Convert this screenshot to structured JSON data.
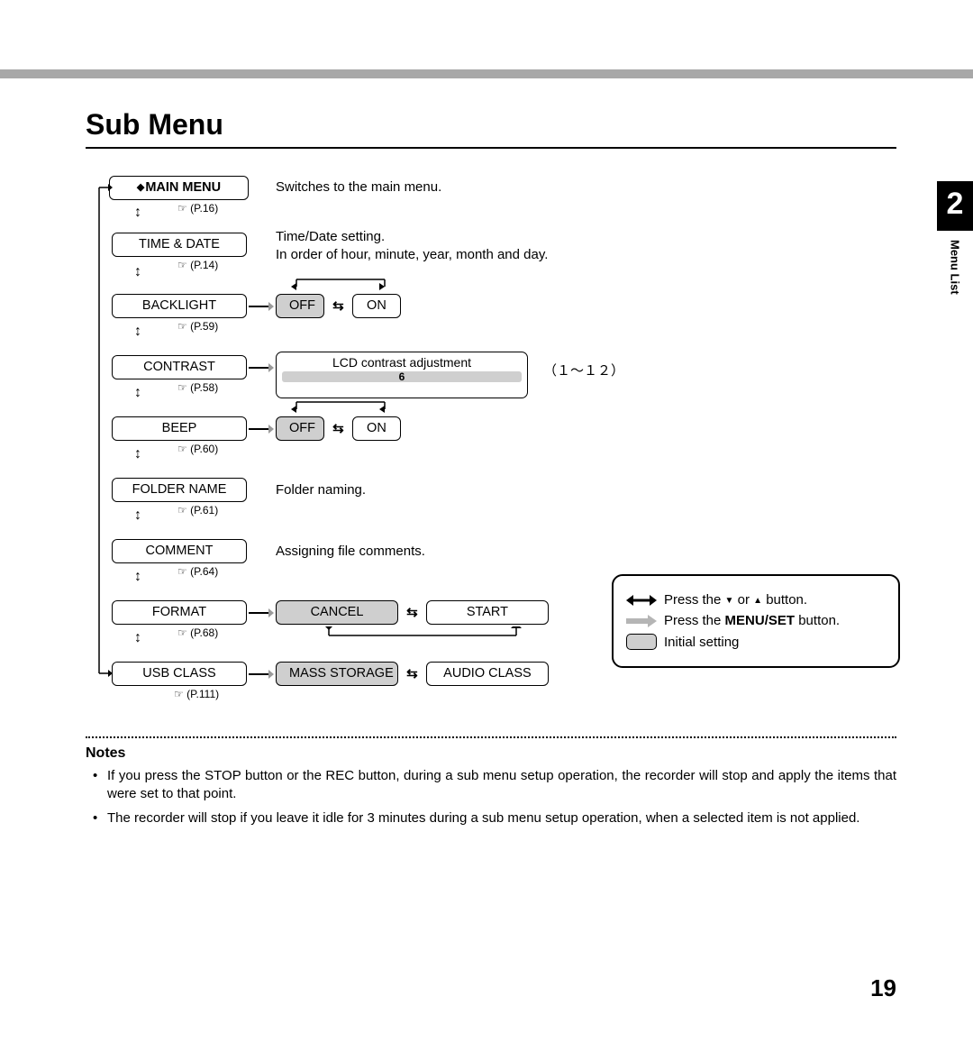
{
  "page": {
    "title": "Sub Menu",
    "number": "19",
    "chapter_number": "2",
    "chapter_label": "Menu List"
  },
  "menu": {
    "main": {
      "label": "MAIN MENU",
      "page_ref": "P.16",
      "desc": "Switches to the main menu."
    },
    "time_date": {
      "label": "TIME & DATE",
      "page_ref": "P.14",
      "desc": "Time/Date setting.\nIn order of hour, minute, year, month and day."
    },
    "backlight": {
      "label": "BACKLIGHT",
      "page_ref": "P.59",
      "options": {
        "off": "OFF",
        "on": "ON"
      }
    },
    "contrast": {
      "label": "CONTRAST",
      "page_ref": "P.58",
      "title": "LCD contrast adjustment",
      "value": "6",
      "range": "（１～１２）"
    },
    "beep": {
      "label": "BEEP",
      "page_ref": "P.60",
      "options": {
        "off": "OFF",
        "on": "ON"
      }
    },
    "folder_name": {
      "label": "FOLDER NAME",
      "page_ref": "P.61",
      "desc": "Folder naming."
    },
    "comment": {
      "label": "COMMENT",
      "page_ref": "P.64",
      "desc": "Assigning file comments."
    },
    "format": {
      "label": "FORMAT",
      "page_ref": "P.68",
      "options": {
        "cancel": "CANCEL",
        "start": "START"
      }
    },
    "usb_class": {
      "label": "USB CLASS",
      "page_ref": "P.111",
      "options": {
        "mass": "MASS STORAGE",
        "audio": "AUDIO CLASS"
      }
    }
  },
  "legend": {
    "updown_prefix": "Press the ",
    "updown_mid": " or ",
    "updown_suffix": " button.",
    "menuset_prefix": "Press the ",
    "menuset_bold": "MENU/SET",
    "menuset_suffix": " button.",
    "initial": "Initial setting"
  },
  "notes": {
    "heading": "Notes",
    "items": [
      "If you press the STOP button or the REC button, during a sub menu setup operation, the recorder will stop and apply the items that were set to that point.",
      "The recorder will stop if you leave it idle for 3 minutes during a sub menu setup operation, when a selected item is not applied."
    ]
  }
}
